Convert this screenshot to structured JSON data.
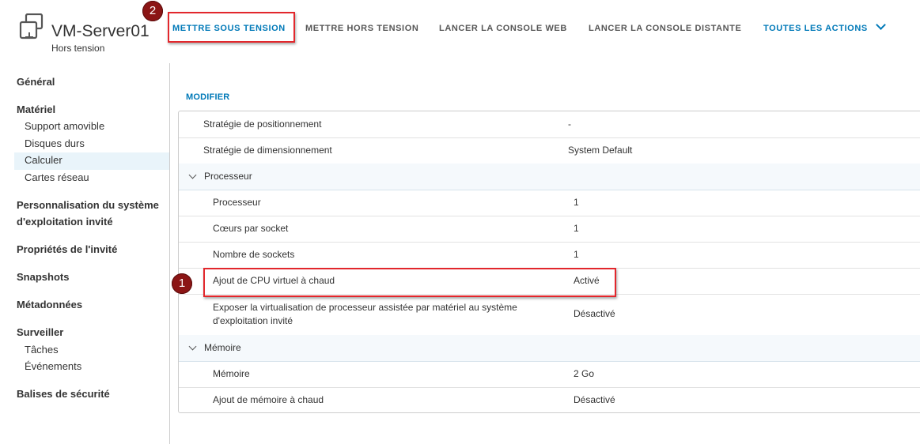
{
  "header": {
    "vm_name": "VM-Server01",
    "vm_status": "Hors tension",
    "actions": {
      "power_on": "METTRE SOUS TENSION",
      "power_off": "METTRE HORS TENSION",
      "web_console": "LANCER LA CONSOLE WEB",
      "remote_console": "LANCER LA CONSOLE DISTANTE",
      "all_actions": "TOUTES LES ACTIONS"
    }
  },
  "sidebar": {
    "general": "Général",
    "hardware": "Matériel",
    "hardware_items": [
      "Support amovible",
      "Disques durs",
      "Calculer",
      "Cartes réseau"
    ],
    "guest_os_customization_line1": "Personnalisation du système",
    "guest_os_customization_line2": "d'exploitation invité",
    "guest_properties": "Propriétés de l'invité",
    "snapshots": "Snapshots",
    "metadata": "Métadonnées",
    "monitor": "Surveiller",
    "monitor_items": [
      "Tâches",
      "Événements"
    ],
    "security_tags": "Balises de sécurité"
  },
  "main": {
    "edit_label": "MODIFIER",
    "rows": [
      {
        "label": "Stratégie de positionnement",
        "value": "-"
      },
      {
        "label": "Stratégie de dimensionnement",
        "value": "System Default"
      }
    ],
    "processor_group": "Processeur",
    "processor_rows": [
      {
        "label": "Processeur",
        "value": "1"
      },
      {
        "label": "Cœurs par socket",
        "value": "1"
      },
      {
        "label": "Nombre de sockets",
        "value": "1"
      },
      {
        "label": "Ajout de CPU virtuel à chaud",
        "value": "Activé"
      }
    ],
    "hw_virt_label_line1": "Exposer la virtualisation de processeur assistée par matériel au système",
    "hw_virt_label_line2": "d'exploitation invité",
    "hw_virt_value": "Désactivé",
    "memory_group": "Mémoire",
    "memory_rows": [
      {
        "label": "Mémoire",
        "value": "2 Go"
      },
      {
        "label": "Ajout de mémoire à chaud",
        "value": "Désactivé"
      }
    ]
  },
  "annotations": {
    "badge_1": "1",
    "badge_2": "2",
    "highlight_color": "#e2272c",
    "badge_color": "#8b1515"
  },
  "colors": {
    "accent": "#0079b8",
    "selected_nav": "#e9f4fa"
  }
}
